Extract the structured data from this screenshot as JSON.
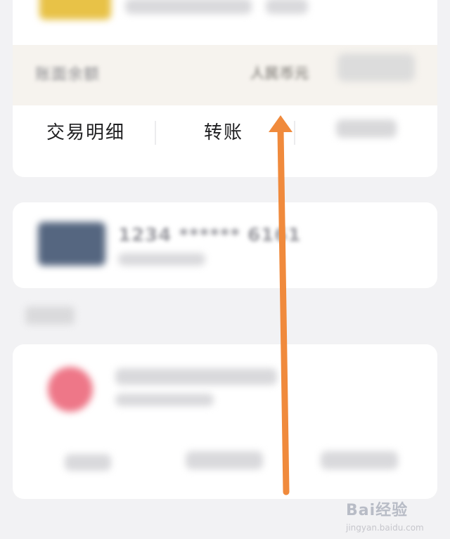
{
  "balance": {
    "label": "账面余额",
    "currency": "人民币元"
  },
  "actions": {
    "transactions": "交易明细",
    "transfer": "转账"
  },
  "bank_card": {
    "number": "1234 ****** 6161"
  },
  "overlay": {
    "arrow_color": "#f08a3c",
    "arrow_direction": "up"
  },
  "watermark": {
    "text": "Bai经验",
    "sub": "jingyan.baidu.com"
  },
  "colors": {
    "background": "#f2f2f4",
    "gold_card": "#e8c247",
    "bank_thumb": "#556680",
    "pink_avatar": "#ee7788"
  }
}
